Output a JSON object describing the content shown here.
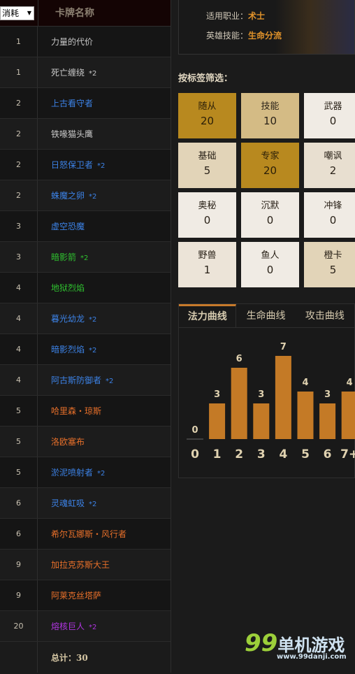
{
  "table": {
    "sort_select": "消耗",
    "name_header": "卡牌名称",
    "rows": [
      {
        "cost": "1",
        "name": "力量的代价",
        "count": "",
        "color": "#c8c8c8"
      },
      {
        "cost": "1",
        "name": "死亡缠绕",
        "count": "*2",
        "color": "#c8c8c8"
      },
      {
        "cost": "2",
        "name": "上古看守者",
        "count": "",
        "color": "#3c82e6"
      },
      {
        "cost": "2",
        "name": "铁喙猫头鹰",
        "count": "",
        "color": "#c8c8c8"
      },
      {
        "cost": "2",
        "name": "日怒保卫者",
        "count": "*2",
        "color": "#3c82e6"
      },
      {
        "cost": "2",
        "name": "蛛魔之卵",
        "count": "*2",
        "color": "#3c82e6"
      },
      {
        "cost": "3",
        "name": "虚空恐魔",
        "count": "",
        "color": "#3c82e6"
      },
      {
        "cost": "3",
        "name": "暗影箭",
        "count": "*2",
        "color": "#2fc02f"
      },
      {
        "cost": "4",
        "name": "地狱烈焰",
        "count": "",
        "color": "#2fc02f"
      },
      {
        "cost": "4",
        "name": "暮光幼龙",
        "count": "*2",
        "color": "#3c82e6"
      },
      {
        "cost": "4",
        "name": "暗影烈焰",
        "count": "*2",
        "color": "#3c82e6"
      },
      {
        "cost": "4",
        "name": "阿古斯防御者",
        "count": "*2",
        "color": "#3c82e6"
      },
      {
        "cost": "5",
        "name": "哈里森・琼斯",
        "count": "",
        "color": "#e8702a"
      },
      {
        "cost": "5",
        "name": "洛欧塞布",
        "count": "",
        "color": "#e8702a"
      },
      {
        "cost": "5",
        "name": "淤泥喷射者",
        "count": "*2",
        "color": "#3c82e6"
      },
      {
        "cost": "6",
        "name": "灵魂虹吸",
        "count": "*2",
        "color": "#3c82e6"
      },
      {
        "cost": "6",
        "name": "希尔瓦娜斯・风行者",
        "count": "",
        "color": "#e8702a"
      },
      {
        "cost": "9",
        "name": "加拉克苏斯大王",
        "count": "",
        "color": "#e8702a"
      },
      {
        "cost": "9",
        "name": "阿莱克丝塔萨",
        "count": "",
        "color": "#e8702a"
      },
      {
        "cost": "20",
        "name": "熔核巨人",
        "count": "*2",
        "color": "#b035e0"
      }
    ],
    "total": "总计：30"
  },
  "hero": {
    "class_label": "适用职业：",
    "class_value": "术士",
    "power_label": "英雄技能：",
    "power_value": "生命分流"
  },
  "filter": {
    "title": "按标签筛选：",
    "tags": [
      {
        "label": "随从",
        "value": "20",
        "color": "#b8891f"
      },
      {
        "label": "技能",
        "value": "10",
        "color": "#d4bb85"
      },
      {
        "label": "武器",
        "value": "0",
        "color": "#f0ebe4"
      },
      {
        "label": "基础",
        "value": "5",
        "color": "#e2d4b8"
      },
      {
        "label": "专家",
        "value": "20",
        "color": "#b8891f"
      },
      {
        "label": "嘲讽",
        "value": "2",
        "color": "#e8dfd0"
      },
      {
        "label": "奥秘",
        "value": "0",
        "color": "#f0ebe4"
      },
      {
        "label": "沉默",
        "value": "0",
        "color": "#f0ebe4"
      },
      {
        "label": "冲锋",
        "value": "0",
        "color": "#f0ebe4"
      },
      {
        "label": "野兽",
        "value": "1",
        "color": "#ece4d8"
      },
      {
        "label": "鱼人",
        "value": "0",
        "color": "#f0ebe4"
      },
      {
        "label": "橙卡",
        "value": "5",
        "color": "#e2d4b8"
      }
    ]
  },
  "tabs": [
    "法力曲线",
    "生命曲线",
    "攻击曲线"
  ],
  "chart_data": {
    "type": "bar",
    "categories": [
      "0",
      "1",
      "2",
      "3",
      "4",
      "5",
      "6",
      "7+"
    ],
    "values": [
      0,
      3,
      6,
      3,
      7,
      4,
      3,
      4
    ],
    "bar_color": "#c47a26"
  },
  "watermark": {
    "brand": "99单机游戏",
    "url": "www.99danji.com"
  }
}
